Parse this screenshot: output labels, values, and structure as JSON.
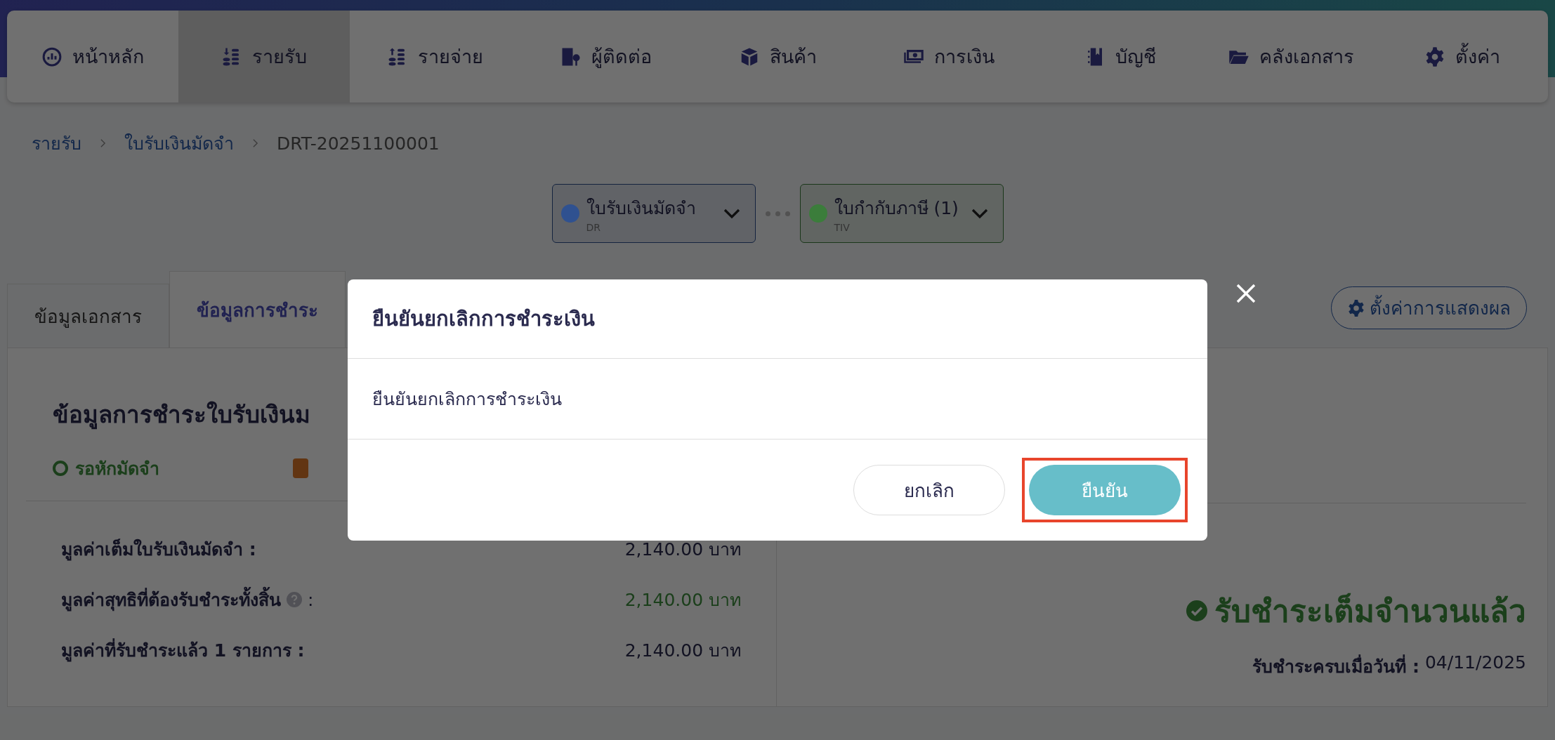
{
  "nav": {
    "items": [
      {
        "label": "หน้าหลัก",
        "selected": false
      },
      {
        "label": "รายรับ",
        "selected": true
      },
      {
        "label": "รายจ่าย",
        "selected": false
      },
      {
        "label": "ผู้ติดต่อ",
        "selected": false
      },
      {
        "label": "สินค้า",
        "selected": false
      },
      {
        "label": "การเงิน",
        "selected": false
      },
      {
        "label": "บัญชี",
        "selected": false
      },
      {
        "label": "คลังเอกสาร",
        "selected": false
      },
      {
        "label": "ตั้งค่า",
        "selected": false
      }
    ]
  },
  "breadcrumb": [
    {
      "label": "รายรับ",
      "kind": "link"
    },
    {
      "label": "ใบรับเงินมัดจำ",
      "kind": "link"
    },
    {
      "label": "DRT-20251100001",
      "kind": "current"
    }
  ],
  "doc_flow": [
    {
      "title": "ใบรับเงินมัดจำ",
      "code": "DR",
      "color": "#2f5190"
    },
    {
      "title": "ใบกำกับภาษี (1)",
      "code": "TIV",
      "color": "#3b7d3b"
    }
  ],
  "tabs": [
    {
      "label": "ข้อมูลเอกสาร",
      "selected": false
    },
    {
      "label": "ข้อมูลการชำระ",
      "selected": true
    }
  ],
  "settings_button": {
    "label": "ตั้งค่าการแสดงผล"
  },
  "payment": {
    "heading": "ข้อมูลการชำระใบรับเงินม",
    "status": "รอหักมัดจำ",
    "rows": [
      {
        "label": "มูลค่าเต็มใบรับเงินมัดจำ :",
        "value": "2,140.00 บาท",
        "help": false,
        "emphasis": false
      },
      {
        "label": "มูลค่าสุทธิที่ต้องรับชำระทั้งสิ้น",
        "label_end": ":",
        "value": "2,140.00 บาท",
        "help": true,
        "emphasis": true
      },
      {
        "label": "มูลค่าที่รับชำระแล้ว 1 รายการ :",
        "value": "2,140.00 บาท",
        "help": false,
        "emphasis": false
      }
    ],
    "result": "รับชำระเต็มจำนวนแล้ว",
    "date_label": "รับชำระครบเมื่อวันที่ :",
    "date": "04/11/2025"
  },
  "dialog": {
    "title": "ยืนยันยกเลิกการชำระเงิน",
    "message": "ยืนยันยกเลิกการชำระเงิน",
    "buttons": [
      {
        "label": "ยกเลิก",
        "kind": "secondary",
        "highlighted": false
      },
      {
        "label": "ยืนยัน",
        "kind": "primary",
        "highlighted": true
      }
    ]
  }
}
